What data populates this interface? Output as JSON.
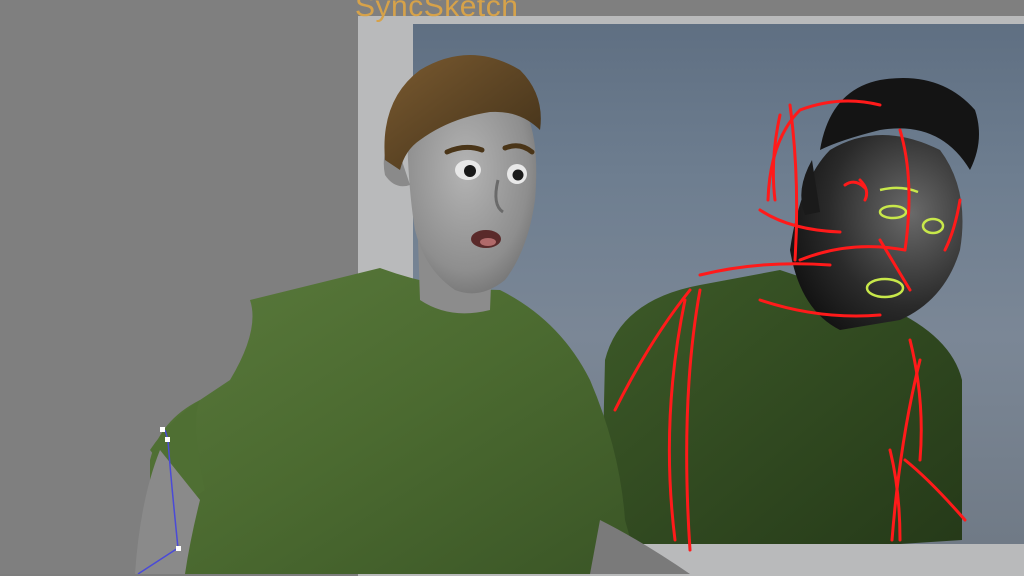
{
  "viewport": {
    "overlay_brand": "SyncSketch",
    "background_color": "#7f7f7f",
    "reference_backdrop": [
      "#5f6f82",
      "#7b8796"
    ]
  },
  "characters": {
    "rendered_character": {
      "shirt_color": "#4b6a30",
      "hair_color": "#5a4424",
      "skin_color": "#9a9a9a"
    },
    "reference_character": {
      "shirt_color": "#2f4a1f",
      "annotation_color": "#ff1a1a",
      "eye_marker_color": "#c8e84a"
    }
  },
  "rig_controls": {
    "handle_color": "#4a4ad8",
    "handle_count": 2
  }
}
